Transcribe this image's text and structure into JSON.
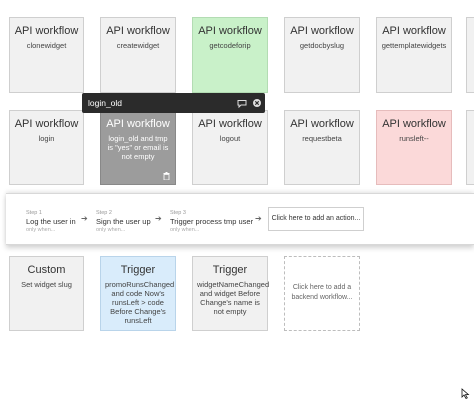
{
  "workflows_row1": [
    {
      "title": "API workflow",
      "sub": "clonewidget"
    },
    {
      "title": "API workflow",
      "sub": "createwidget"
    },
    {
      "title": "API workflow",
      "sub": "getcodeforip"
    },
    {
      "title": "API workflow",
      "sub": "getdocbyslug"
    },
    {
      "title": "API workflow",
      "sub": "gettemplatewidgets"
    }
  ],
  "workflows_row2": [
    {
      "title": "API workflow",
      "sub": "login"
    },
    {
      "title": "API workflow",
      "sub": "login_old and tmp is \"yes\" or email is not empty"
    },
    {
      "title": "API workflow",
      "sub": "logout"
    },
    {
      "title": "API workflow",
      "sub": "requestbeta"
    },
    {
      "title": "API workflow",
      "sub": "runsleft--"
    }
  ],
  "colors": {
    "green_card": "#c9f1c9",
    "red_card": "#fbd9d9",
    "blue_card": "#d9ecfb",
    "selected_card": "#9c9c9c",
    "tooltip_bg": "#2b2b2b"
  },
  "tooltip": {
    "label": "login_old",
    "icons": [
      "comment-icon",
      "close-icon"
    ]
  },
  "steps_panel": {
    "steps": [
      {
        "num": "Step 1",
        "name": "Log the user in",
        "only": "only when..."
      },
      {
        "num": "Step 2",
        "name": "Sign the user up",
        "only": "only when..."
      },
      {
        "num": "Step 3",
        "name": "Trigger process tmp user",
        "only": "only when..."
      }
    ],
    "add_action": "Click here to add an action..."
  },
  "workflows_row3": [
    {
      "title": "Custom",
      "sub": "Set widget slug"
    },
    {
      "title": "Trigger",
      "sub": "promoRunsChanged and code Now's runsLeft > code Before Change's runsLeft"
    },
    {
      "title": "Trigger",
      "sub": "widgetNameChanged and widget Before Change's name is not empty"
    }
  ],
  "add_backend": "Click here to add a backend workflow..."
}
